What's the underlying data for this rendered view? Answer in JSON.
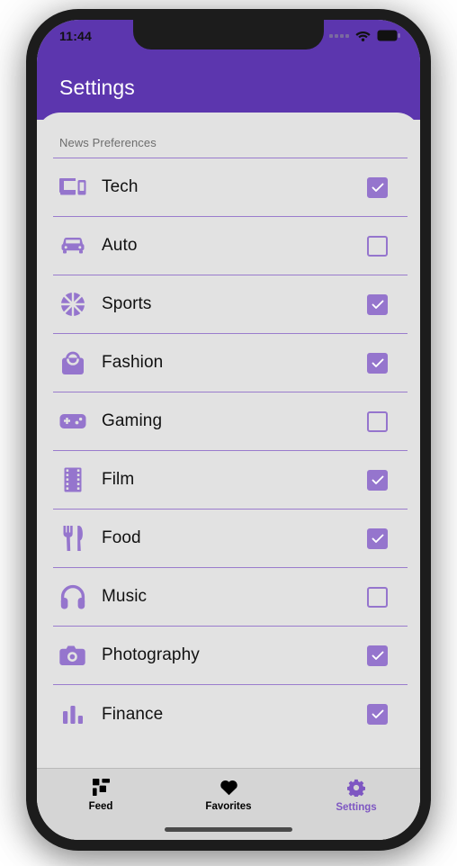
{
  "status_bar": {
    "time": "11:44",
    "signal_icon": "signal-dots-icon",
    "wifi_icon": "wifi-icon",
    "battery_icon": "battery-full-icon"
  },
  "app_bar": {
    "title": "Settings",
    "background_color": "#5c36ae"
  },
  "content": {
    "section_header": "News Preferences",
    "accent_color": "#9575cd",
    "divider_color": "#9a7ccd",
    "items": [
      {
        "label": "Tech",
        "icon": "devices-icon",
        "checked": true
      },
      {
        "label": "Auto",
        "icon": "car-icon",
        "checked": false
      },
      {
        "label": "Sports",
        "icon": "basketball-icon",
        "checked": true
      },
      {
        "label": "Fashion",
        "icon": "handbag-icon",
        "checked": true
      },
      {
        "label": "Gaming",
        "icon": "gamepad-icon",
        "checked": false
      },
      {
        "label": "Film",
        "icon": "film-strip-icon",
        "checked": true
      },
      {
        "label": "Food",
        "icon": "fork-knife-icon",
        "checked": true
      },
      {
        "label": "Music",
        "icon": "headphones-icon",
        "checked": false
      },
      {
        "label": "Photography",
        "icon": "camera-icon",
        "checked": true
      },
      {
        "label": "Finance",
        "icon": "bar-chart-icon",
        "checked": true
      }
    ]
  },
  "tab_bar": {
    "active_color": "#7e57c2",
    "inactive_color": "#000000",
    "tabs": [
      {
        "label": "Feed",
        "icon": "grid-icon",
        "active": false
      },
      {
        "label": "Favorites",
        "icon": "heart-icon",
        "active": false
      },
      {
        "label": "Settings",
        "icon": "gear-icon",
        "active": true
      }
    ]
  }
}
